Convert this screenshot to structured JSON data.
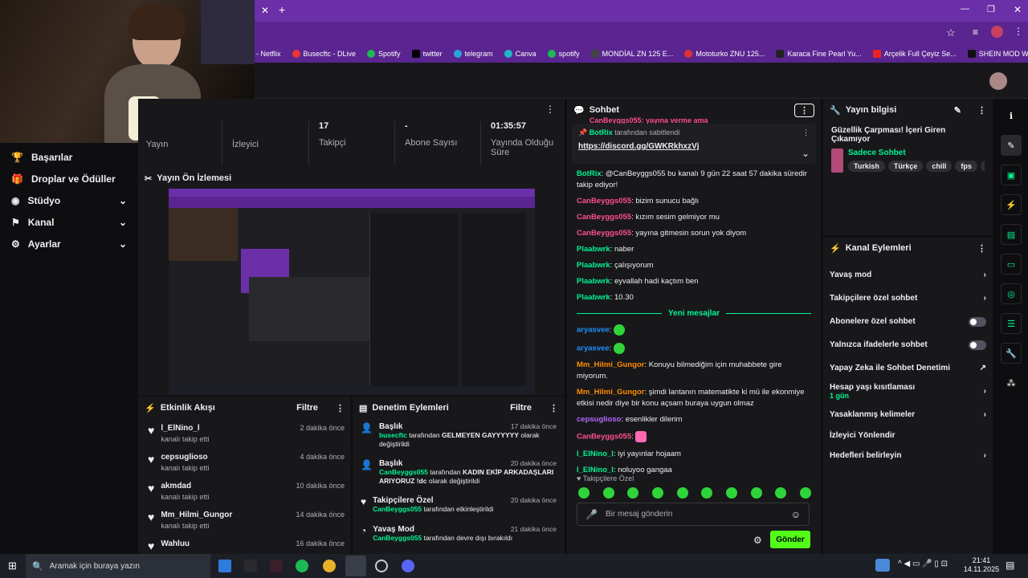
{
  "browser": {
    "bookmarks": [
      "s - Netflix",
      "Busecftc - DLive",
      "Spotify",
      "twitter",
      "telegram",
      "Canva",
      "spotify",
      "MONDİAL ZN 125 E...",
      "Mototurko ZNU 125...",
      "Karaca Fine Pearl Yu...",
      "Arçelik Full Çeyiz Se...",
      "SHEIN MOD Wome..."
    ]
  },
  "leftnav": {
    "items": [
      {
        "label": "Başarılar",
        "icon": "trophy-icon"
      },
      {
        "label": "Droplar ve Ödüller",
        "icon": "gift-icon"
      },
      {
        "label": "Stüdyo",
        "icon": "studio-icon"
      },
      {
        "label": "Kanal",
        "icon": "channel-icon"
      },
      {
        "label": "Ayarlar",
        "icon": "gear-icon"
      }
    ]
  },
  "stats": [
    {
      "value": "",
      "label": "Yayın"
    },
    {
      "value": "",
      "label": "İzleyici"
    },
    {
      "value": "17",
      "label": "Takipçi"
    },
    {
      "value": "-",
      "label": "Abone Sayısı"
    },
    {
      "value": "01:35:57",
      "label": "Yayında Olduğu Süre"
    }
  ],
  "preview": {
    "title": "Yayın Ön İzlemesi"
  },
  "activity": {
    "title": "Etkinlik Akışı",
    "filter": "Filtre",
    "items": [
      {
        "name": "l_ElNino_l",
        "sub": "kanalı takip etti",
        "time": "2 dakika önce"
      },
      {
        "name": "cepsuglioso",
        "sub": "kanalı takip etti",
        "time": "4 dakika önce"
      },
      {
        "name": "akmdad",
        "sub": "kanalı takip etti",
        "time": "10 dakika önce"
      },
      {
        "name": "Mm_Hilmi_Gungor",
        "sub": "kanalı takip etti",
        "time": "14 dakika önce"
      },
      {
        "name": "Wahluu",
        "sub": "",
        "time": "16 dakika önce"
      }
    ]
  },
  "modactions": {
    "title": "Denetim Eylemleri",
    "filter": "Filtre",
    "items": [
      {
        "title": "Başlık",
        "time": "17 dakika önce",
        "user": "busecftc",
        "text1": "tarafından",
        "bold": "GELMEYEN GAYYYYYY",
        "text2": "olarak değiştirildi"
      },
      {
        "title": "Başlık",
        "time": "20 dakika önce",
        "user": "CanBeyggs055",
        "text1": "tarafından",
        "bold": "KADIN EKİP ARKADAŞLARI ARIYORUZ !dc",
        "text2": "olarak değiştirildi"
      },
      {
        "title": "Takipçilere Özel",
        "time": "20 dakika önce",
        "user": "CanBeyggs055",
        "text1": "tarafından etkinleştirildi",
        "bold": "",
        "text2": ""
      },
      {
        "title": "Yavaş Mod",
        "time": "21 dakika önce",
        "user": "CanBeyggs055",
        "text1": "tarafından devre dışı bırakıldı",
        "bold": "",
        "text2": ""
      }
    ]
  },
  "chat": {
    "title": "Sohbet",
    "pinned_by": "BotRix",
    "pinned_text": "tarafından sabitlendi",
    "pinned_link": "https://discord.gg/GWKRkhxzVj",
    "top_partial": "CanBeyggs055: yayına verme ama",
    "messages": [
      {
        "user": "BotRix",
        "color": "#00f593",
        "text": ": @CanBeyggs055 bu kanalı 9 gün 22 saat 57 dakika süredir takip ediyor!"
      },
      {
        "user": "CanBeyggs055",
        "color": "#ff4f8b",
        "text": ": bizim sunucu bağlı"
      },
      {
        "user": "CanBeyggs055",
        "color": "#ff4f8b",
        "text": ": kızım sesim gelmiyor mu"
      },
      {
        "user": "CanBeyggs055",
        "color": "#ff4f8b",
        "text": ": yayına gitmesin sorun yok diyom"
      },
      {
        "user": "Plaabwrk",
        "color": "#00f593",
        "text": ": naber"
      },
      {
        "user": "Plaabwrk",
        "color": "#00f593",
        "text": ": çalışıyorum"
      },
      {
        "user": "Plaabwrk",
        "color": "#00f593",
        "text": ": eyvallah hadi kaçtım ben"
      },
      {
        "user": "Plaabwrk",
        "color": "#00f593",
        "text": ": 10.30"
      }
    ],
    "new_messages": "Yeni mesajlar",
    "messages2": [
      {
        "user": "aryasvee",
        "color": "#1e90ff",
        "text": ":"
      },
      {
        "user": "aryasvee",
        "color": "#1e90ff",
        "text": ":"
      },
      {
        "user": "Mm_Hilmi_Gungor",
        "color": "#ff8c00",
        "text": ": Konuyu bilmediğim için muhabbete gire miyorum."
      },
      {
        "user": "Mm_Hilmi_Gungor",
        "color": "#ff8c00",
        "text": ": şimdi lantanın matematikte ki mü ile ekonmiye etkisi nedir diye bir konu açsam buraya uygun olmaz"
      },
      {
        "user": "cepsuglioso",
        "color": "#b266ff",
        "text": ": esenlikler dilerim"
      },
      {
        "user": "CanBeyggs055",
        "color": "#ff4f8b",
        "text": ":"
      },
      {
        "user": "l_ElNino_l",
        "color": "#00f593",
        "text": ": iyi yayınlar hojaam"
      },
      {
        "user": "l_ElNino_l",
        "color": "#00f593",
        "text": ": noluyoo gangaa"
      }
    ],
    "emote_bar_label": "Takipçilere Özel",
    "input_placeholder": "Bir mesaj gönderin",
    "send": "Gönder"
  },
  "info": {
    "title": "Yayın bilgisi",
    "stream_title": "Güzellik Çarpması! İçeri Giren Çıkamıyor",
    "category": "Sadece Sohbet",
    "tags": [
      "Turkish",
      "Türkçe",
      "chill",
      "fps",
      "fu"
    ]
  },
  "channel": {
    "title": "Kanal Eylemleri",
    "rows": [
      {
        "label": "Yavaş mod",
        "control": "chevron"
      },
      {
        "label": "Takipçilere özel sohbet",
        "control": "chevron"
      },
      {
        "label": "Abonelere özel sohbet",
        "control": "toggle"
      },
      {
        "label": "Yalnızca ifadelerle sohbet",
        "control": "toggle"
      },
      {
        "label": "Yapay Zeka ile Sohbet Denetimi",
        "control": "external"
      },
      {
        "label": "Hesap yaşı kısıtlaması",
        "sub": "1 gün",
        "control": "chevron"
      },
      {
        "label": "Yasaklanmış kelimeler",
        "control": "chevron"
      },
      {
        "label": "İzleyici Yönlendir",
        "control": "none"
      },
      {
        "label": "Hedefleri belirleyin",
        "control": "chevron"
      }
    ]
  },
  "taskbar": {
    "search": "Aramak için buraya yazın",
    "time": "21:41",
    "date": "14.11.2025"
  }
}
